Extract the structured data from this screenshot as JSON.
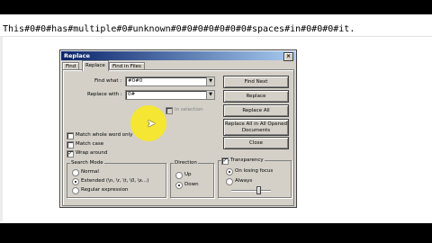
{
  "editor": {
    "line_text": "This#0#0#has#multiple#0#unknown#0#0#0#0#0#0#0#spaces#in#0#0#0#it."
  },
  "dialog": {
    "title": "Replace",
    "close_glyph": "×",
    "tabs": [
      {
        "label": "Find",
        "active": false
      },
      {
        "label": "Replace",
        "active": true
      },
      {
        "label": "Find in Files",
        "active": false
      }
    ],
    "find_what_label": "Find what :",
    "find_what_value": "#0#0",
    "replace_with_label": "Replace with :",
    "replace_with_value": "0#",
    "in_selection_label": "In selection",
    "buttons": {
      "find_next": "Find Next",
      "replace": "Replace",
      "replace_all": "Replace All",
      "replace_all_open_1": "Replace All in All Opened",
      "replace_all_open_2": "Documents",
      "close": "Close"
    },
    "options": {
      "match_whole_word": {
        "label": "Match whole word only",
        "checked": false
      },
      "match_case": {
        "label": "Match case",
        "checked": false
      },
      "wrap_around": {
        "label": "Wrap around",
        "checked": true
      }
    },
    "search_mode": {
      "title": "Search Mode",
      "normal": "Normal",
      "extended": "Extended (\\n, \\r, \\t, \\0, \\x...)",
      "regex": "Regular expression",
      "selected": "extended"
    },
    "direction": {
      "title": "Direction",
      "up": "Up",
      "down": "Down",
      "selected": "down"
    },
    "transparency": {
      "title": "Transparency",
      "checked": true,
      "on_losing_focus": "On losing focus",
      "always": "Always",
      "selected": "on_losing_focus"
    }
  }
}
